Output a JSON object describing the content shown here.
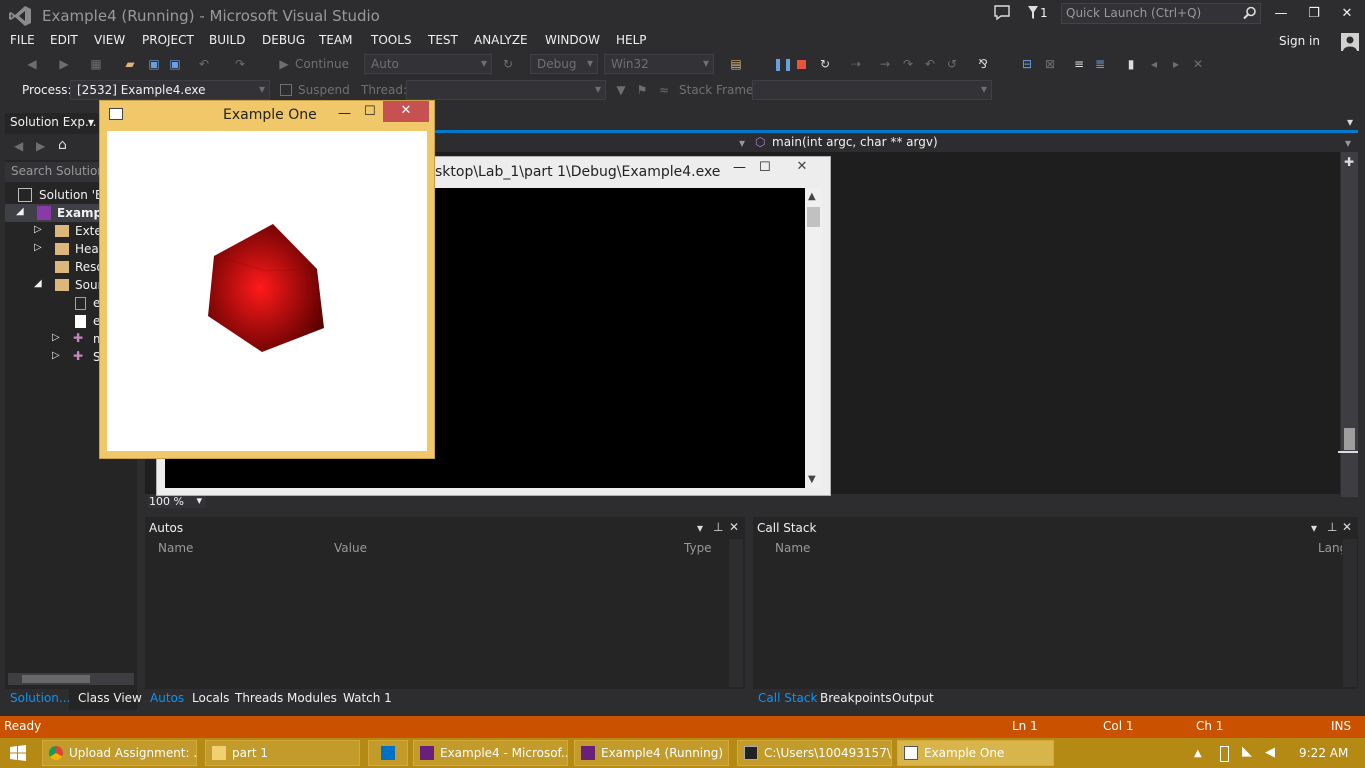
{
  "title_bar": {
    "title": "Example4 (Running) - Microsoft Visual Studio",
    "flag_count": "1",
    "quick_launch_placeholder": "Quick Launch (Ctrl+Q)",
    "min": "—",
    "restore": "❐",
    "close": "✕"
  },
  "menu": {
    "items": [
      "FILE",
      "EDIT",
      "VIEW",
      "PROJECT",
      "BUILD",
      "DEBUG",
      "TEAM",
      "TOOLS",
      "TEST",
      "ANALYZE",
      "WINDOW",
      "HELP"
    ],
    "sign_in": "Sign in"
  },
  "toolbar": {
    "continue": "Continue",
    "auto": "Auto",
    "config": "Debug",
    "platform": "Win32",
    "process_label": "Process:",
    "process_value": "[2532] Example4.exe",
    "suspend": "Suspend",
    "thread_label": "Thread:",
    "stack_frame_label": "Stack Frame:"
  },
  "solution_explorer": {
    "header": "Solution Exp...",
    "search_placeholder": "Search Solution E",
    "items": [
      "Solution 'Ex",
      "Example",
      "Exter",
      "Head",
      "Reso",
      "Sour",
      "e",
      "e",
      "m",
      "S"
    ],
    "tab_solution": "Solution...",
    "tab_class_view": "Class View"
  },
  "editor": {
    "function_nav": "main(int argc, char ** argv)",
    "zoom": "100 %"
  },
  "console_window": {
    "title": "sktop\\Lab_1\\part 1\\Debug\\Example4.exe",
    "min": "—",
    "max": "☐",
    "close": "✕"
  },
  "gl_window": {
    "title": "Example One",
    "min": "—",
    "max": "☐",
    "close": "✕",
    "colors": {
      "cube_light": "#ff1a1a",
      "cube_dark": "#5a0000"
    }
  },
  "autos_panel": {
    "title": "Autos",
    "columns": [
      "Name",
      "Value",
      "Type"
    ],
    "tabs": [
      "Autos",
      "Locals",
      "Threads",
      "Modules",
      "Watch 1"
    ]
  },
  "callstack_panel": {
    "title": "Call Stack",
    "columns": [
      "Name",
      "Lang"
    ],
    "tabs": [
      "Call Stack",
      "Breakpoints",
      "Output"
    ]
  },
  "status_bar": {
    "state": "Ready",
    "line": "Ln 1",
    "col": "Col 1",
    "ch": "Ch 1",
    "mode": "INS"
  },
  "taskbar": {
    "items": [
      "Upload Assignment: ...",
      "part 1",
      "",
      "Example4 - Microsof...",
      "Example4 (Running) ...",
      "C:\\Users\\100493157\\...",
      "Example One"
    ],
    "clock": "9:22 AM"
  }
}
